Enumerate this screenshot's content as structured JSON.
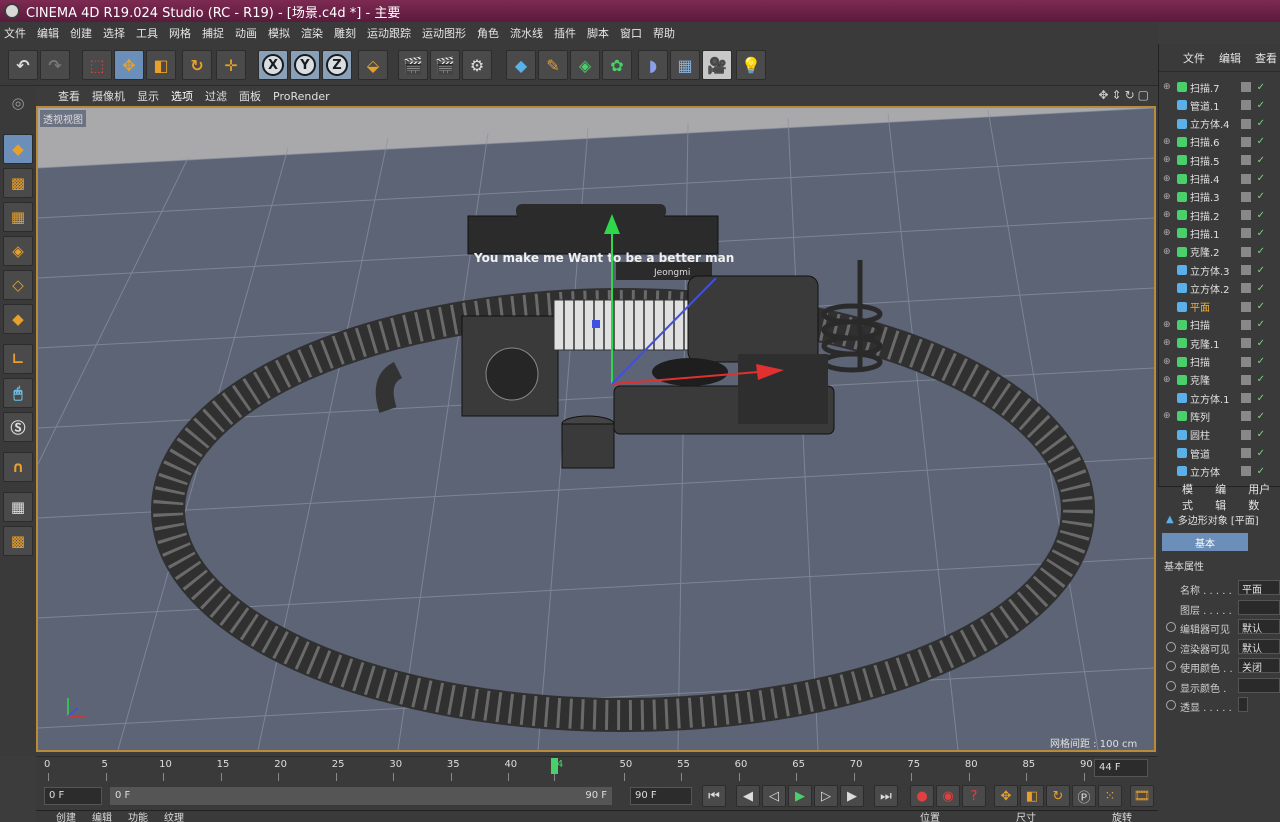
{
  "window": {
    "title": "CINEMA 4D R19.024 Studio (RC - R19) - [场景.c4d *] - 主要"
  },
  "menubar": [
    "文件",
    "编辑",
    "创建",
    "选择",
    "工具",
    "网格",
    "捕捉",
    "动画",
    "模拟",
    "渲染",
    "雕刻",
    "运动跟踪",
    "运动图形",
    "角色",
    "流水线",
    "插件",
    "脚本",
    "窗口",
    "帮助"
  ],
  "toolbar": {
    "x": "X",
    "y": "Y",
    "z": "Z"
  },
  "viewport": {
    "menu": [
      "查看",
      "摄像机",
      "显示",
      "选项",
      "过滤",
      "面板",
      "ProRender"
    ],
    "label": "透视视图",
    "grid_spacing": "网格间距 : 100 cm",
    "sign_text": "You make me Want to be a better man",
    "sign_sub": "Jeongmi"
  },
  "object_manager": {
    "tabs": [
      "文件",
      "编辑",
      "查看"
    ],
    "objects": [
      {
        "name": "扫描.7",
        "icon": "sweep"
      },
      {
        "name": "管道.1",
        "icon": "pipe"
      },
      {
        "name": "立方体.4",
        "icon": "cube"
      },
      {
        "name": "扫描.6",
        "icon": "sweep"
      },
      {
        "name": "扫描.5",
        "icon": "sweep"
      },
      {
        "name": "扫描.4",
        "icon": "sweep"
      },
      {
        "name": "扫描.3",
        "icon": "sweep"
      },
      {
        "name": "扫描.2",
        "icon": "sweep"
      },
      {
        "name": "扫描.1",
        "icon": "sweep"
      },
      {
        "name": "克隆.2",
        "icon": "cloner"
      },
      {
        "name": "立方体.3",
        "icon": "cube"
      },
      {
        "name": "立方体.2",
        "icon": "cube"
      },
      {
        "name": "平面",
        "icon": "plane"
      },
      {
        "name": "扫描",
        "icon": "sweep"
      },
      {
        "name": "克隆.1",
        "icon": "cloner"
      },
      {
        "name": "扫描",
        "icon": "sweep"
      },
      {
        "name": "克隆",
        "icon": "cloner"
      },
      {
        "name": "立方体.1",
        "icon": "cube"
      },
      {
        "name": "阵列",
        "icon": "array"
      },
      {
        "name": "圆柱",
        "icon": "cylinder"
      },
      {
        "name": "管道",
        "icon": "pipe"
      },
      {
        "name": "立方体",
        "icon": "cube"
      }
    ]
  },
  "attribute_manager": {
    "tabs": [
      "模式",
      "编辑",
      "用户数"
    ],
    "object_label": "多边形对象 [平面]",
    "basic_tab": "基本",
    "section": "基本属性",
    "rows": [
      {
        "label": "名称 . . . . .",
        "value": "平面"
      },
      {
        "label": "图层 . . . . .",
        "value": ""
      },
      {
        "label": "编辑器可见",
        "value": "默认"
      },
      {
        "label": "渲染器可见",
        "value": "默认"
      },
      {
        "label": "使用颜色 . .",
        "value": "关闭"
      },
      {
        "label": "显示颜色 .",
        "value": ""
      },
      {
        "label": "透显 . . . . .",
        "value": ""
      }
    ]
  },
  "timeline": {
    "ticks": [
      "0",
      "5",
      "10",
      "15",
      "20",
      "25",
      "30",
      "35",
      "40",
      "44",
      "50",
      "55",
      "60",
      "65",
      "70",
      "75",
      "80",
      "85",
      "90"
    ],
    "current_frame": 44,
    "current_frame_field": "44 F",
    "start_field": "0 F",
    "range_start": "0 F",
    "range_end": "90 F",
    "end_field": "90 F"
  },
  "bottom_tabs": [
    "创建",
    "编辑",
    "功能",
    "纹理",
    "位置",
    "尺寸",
    "旋转"
  ]
}
